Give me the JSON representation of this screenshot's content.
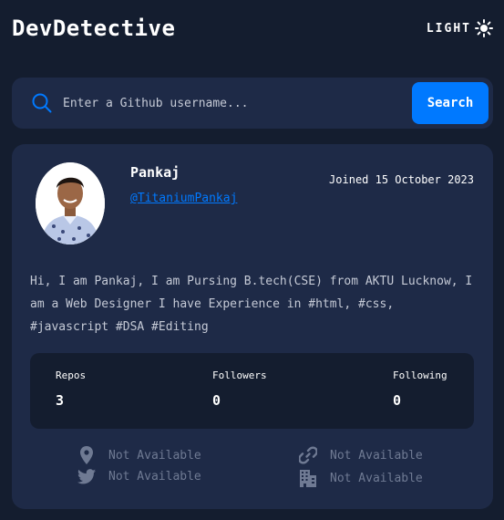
{
  "header": {
    "brand": "DevDetective",
    "mode_label": "LIGHT",
    "mode_icon": "sun-icon"
  },
  "search": {
    "placeholder": "Enter a Github username...",
    "value": "",
    "button_label": "Search"
  },
  "profile": {
    "name": "Pankaj",
    "handle": "@TitaniumPankaj",
    "joined": "Joined 15 October 2023",
    "bio": "Hi, I am Pankaj, I am Pursing B.tech(CSE) from AKTU Lucknow, I am a Web Designer I have Experience in #html, #css, #javascript #DSA #Editing",
    "stats": {
      "repos": {
        "label": "Repos",
        "value": "3"
      },
      "followers": {
        "label": "Followers",
        "value": "0"
      },
      "following": {
        "label": "Following",
        "value": "0"
      }
    },
    "links": {
      "location": {
        "icon": "location-pin-icon",
        "text": "Not Available"
      },
      "website": {
        "icon": "link-icon",
        "text": "Not Available"
      },
      "twitter": {
        "icon": "twitter-icon",
        "text": "Not Available"
      },
      "company": {
        "icon": "building-icon",
        "text": "Not Available"
      }
    }
  },
  "colors": {
    "background": "#141d2f",
    "card": "#1e2a47",
    "accent": "#0079ff",
    "muted": "#6f7a93",
    "text": "#ffffff"
  }
}
